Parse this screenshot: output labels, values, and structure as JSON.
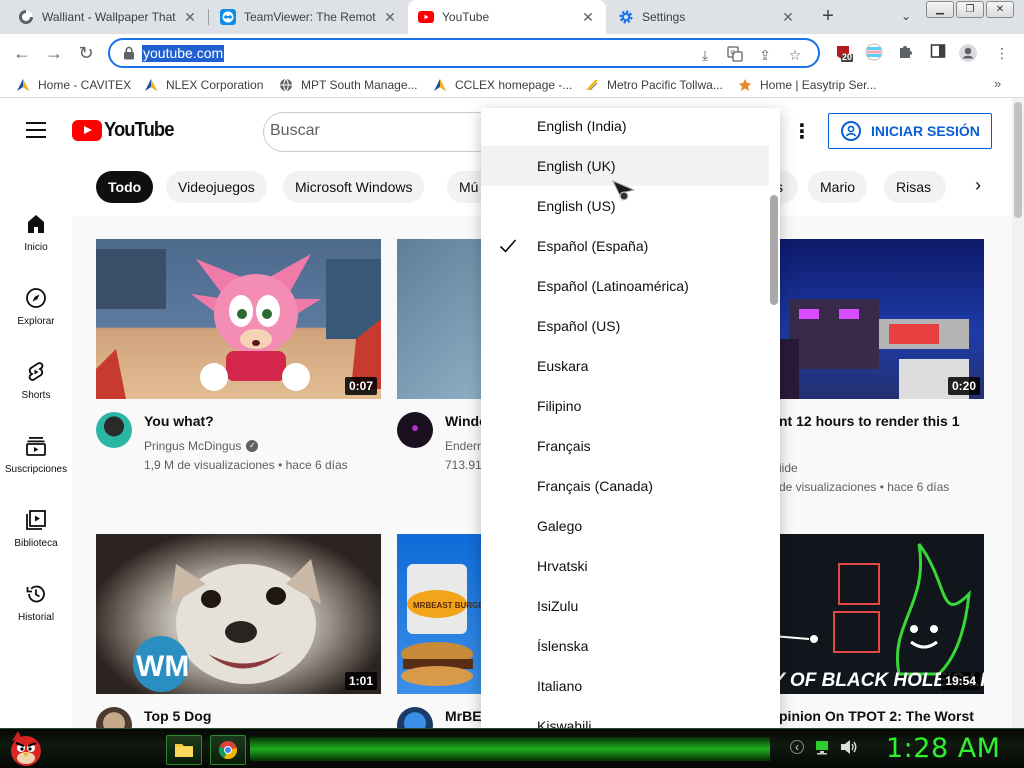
{
  "browser": {
    "tabs": [
      {
        "title": "Walliant - Wallpaper That"
      },
      {
        "title": "TeamViewer: The Remote"
      },
      {
        "title": "YouTube"
      },
      {
        "title": "Settings"
      }
    ],
    "url": "youtube.com",
    "extension_badge": "20",
    "bookmarks": [
      {
        "label": "Home - CAVITEX"
      },
      {
        "label": "NLEX Corporation"
      },
      {
        "label": "MPT South Manage..."
      },
      {
        "label": "CCLEX homepage -..."
      },
      {
        "label": "Metro Pacific Tollwa..."
      },
      {
        "label": "Home | Easytrip Ser..."
      }
    ],
    "bookmarks_more": "»"
  },
  "youtube": {
    "logo_text": "YouTube",
    "search_placeholder": "Buscar",
    "sign_in_label": "INICIAR SESIÓN",
    "chips": [
      "Todo",
      "Videojuegos",
      "Microsoft Windows",
      "Mú",
      "s",
      "Mario",
      "Risas"
    ],
    "guide": [
      {
        "label": "Inicio",
        "icon": "home-icon"
      },
      {
        "label": "Explorar",
        "icon": "compass-icon"
      },
      {
        "label": "Shorts",
        "icon": "shorts-icon"
      },
      {
        "label": "Suscripciones",
        "icon": "subscriptions-icon"
      },
      {
        "label": "Biblioteca",
        "icon": "library-icon"
      },
      {
        "label": "Historial",
        "icon": "history-icon"
      }
    ],
    "videos": [
      {
        "title": "You what?",
        "channel": "Pringus McDingus",
        "meta": "1,9 M de visualizaciones • hace 6 días",
        "duration": "0:07"
      },
      {
        "title": "Windo",
        "channel": "Enderm",
        "meta": "713.91",
        "duration": ""
      },
      {
        "title": "nt 12 hours to render this 1",
        "channel": "iide",
        "meta": "de visualizaciones • hace 6 días",
        "duration": "0:20"
      },
      {
        "title": "Top 5 Dog",
        "channel": "",
        "meta": "",
        "duration": "1:01"
      },
      {
        "title": "MrBE",
        "channel": "",
        "meta": "",
        "duration": ""
      },
      {
        "title": "pinion On TPOT 2: The Worst",
        "channel": "",
        "meta": "",
        "duration": "19:54"
      }
    ],
    "thumb_texts": {
      "watermark": "WM",
      "burger_brand": "MRBEAST BURGER",
      "tpot": "RST DAY OF BLACK HOLE'S LIFE"
    }
  },
  "language_menu": {
    "selected": "Español (España)",
    "hovered": "English (UK)",
    "options": [
      "English (India)",
      "English (UK)",
      "English (US)",
      "Español (España)",
      "Español (Latinoamérica)",
      "Español (US)",
      "Euskara",
      "Filipino",
      "Français",
      "Français (Canada)",
      "Galego",
      "Hrvatski",
      "IsiZulu",
      "Íslenska",
      "Italiano",
      "Kiswahili"
    ]
  },
  "taskbar": {
    "clock": "1:28 AM"
  },
  "colors": {
    "youtube_red": "#ff0000",
    "signin_blue": "#065fd4",
    "omnibox_focus": "#1a73e8",
    "clock_green": "#2ef22e"
  }
}
